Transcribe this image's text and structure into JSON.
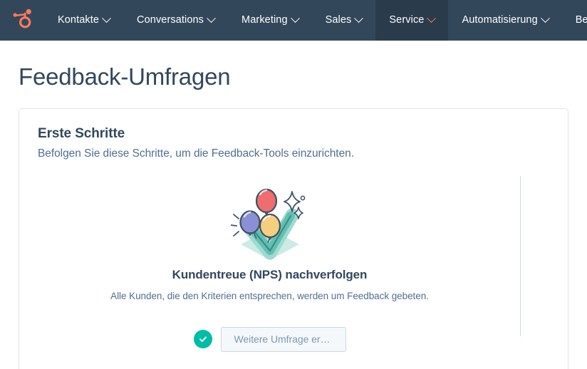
{
  "navbar": {
    "logo_icon": "hubspot-sprocket-logo",
    "logo_color": "#ff7a59",
    "background_color": "#33475b",
    "active_background_color": "#2a3b4c",
    "items": [
      {
        "label": "Kontakte",
        "icon": "chevron-down-icon",
        "active": false
      },
      {
        "label": "Conversations",
        "icon": "chevron-down-icon",
        "active": false
      },
      {
        "label": "Marketing",
        "icon": "chevron-down-icon",
        "active": false
      },
      {
        "label": "Sales",
        "icon": "chevron-down-icon",
        "active": false
      },
      {
        "label": "Service",
        "icon": "chevron-down-icon",
        "active": true
      },
      {
        "label": "Automatisierung",
        "icon": "chevron-down-icon",
        "active": false
      },
      {
        "label": "Berichte",
        "icon": "chevron-down-icon",
        "active": false
      }
    ]
  },
  "page": {
    "title": "Feedback-Umfragen"
  },
  "card": {
    "title": "Erste Schritte",
    "subtitle": "Befolgen Sie diese Schritte, um die Feedback-Tools einzurichten.",
    "steps": [
      {
        "illustration": "balloons-checkmark-illustration",
        "title": "Kundentreue (NPS) nachverfolgen",
        "description": "Alle Kunden, die den Kriterien entsprechen, werden um Feedback gebeten.",
        "status_icon": "check-circle-icon",
        "status_color": "#00bda5",
        "button_label": "Weitere Umfrage ers…"
      }
    ]
  }
}
